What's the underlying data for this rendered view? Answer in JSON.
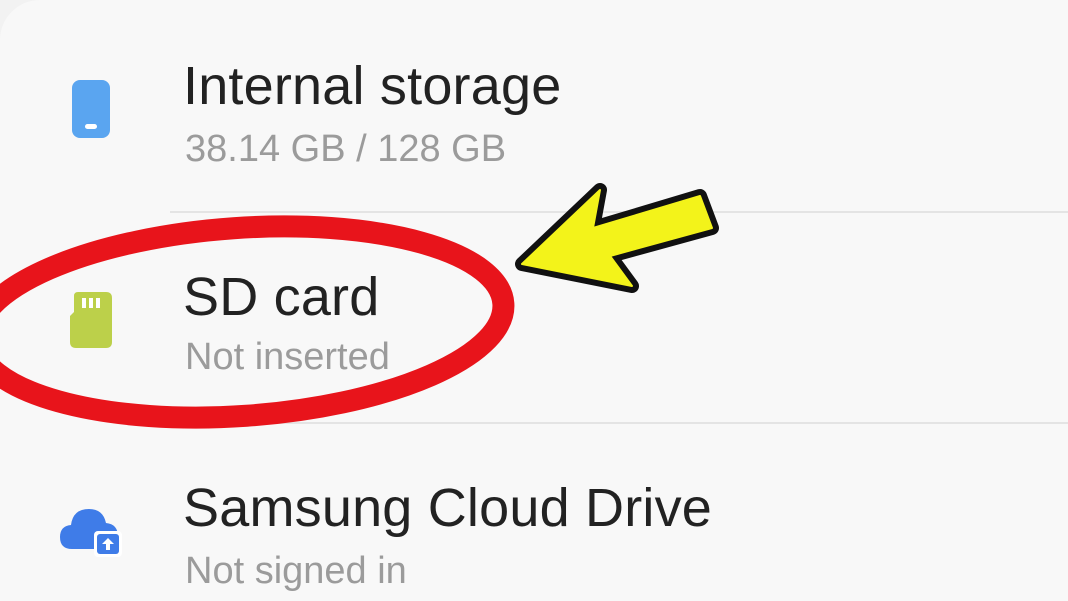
{
  "storage": {
    "items": [
      {
        "title": "Internal storage",
        "subtitle": "38.14 GB / 128 GB",
        "icon": "phone-icon"
      },
      {
        "title": "SD card",
        "subtitle": "Not inserted",
        "icon": "sd-card-icon"
      },
      {
        "title": "Samsung Cloud Drive",
        "subtitle": "Not signed in",
        "icon": "cloud-upload-icon"
      }
    ]
  },
  "colors": {
    "phone_icon": "#5aa5f0",
    "sd_icon": "#bcd04a",
    "cloud_icon": "#3f7ce8",
    "highlight_ellipse": "#e8141b",
    "arrow_fill": "#f3f31a",
    "arrow_stroke": "#111111"
  }
}
